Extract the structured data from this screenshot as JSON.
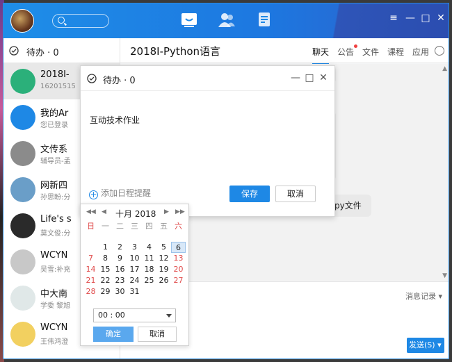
{
  "topbar": {
    "nav": [
      "message-icon",
      "contacts-icon",
      "files-icon"
    ],
    "window_controls": [
      "≡",
      "—",
      "□",
      "✕"
    ]
  },
  "sidebar": {
    "todo_label": "待办 · 0",
    "conversations": [
      {
        "name": "2018I-",
        "sub": "16201515",
        "color": "#2bb07a",
        "active": true
      },
      {
        "name": "我的Ar",
        "sub": "您已登录",
        "color": "#1e88e5"
      },
      {
        "name": "文传系",
        "sub": "辅导员-孟",
        "color": "#8b8b8b"
      },
      {
        "name": "网新四",
        "sub": "孙思盼:分",
        "color": "#6a9ec8"
      },
      {
        "name": "Life's s",
        "sub": "莫文俊:分",
        "color": "#2a2a2a"
      },
      {
        "name": "WCYN",
        "sub": "吴雪:补充",
        "color": "#c8c8c8"
      },
      {
        "name": "中大南",
        "sub": "学委 黎旭",
        "color": "#e0e8e8"
      },
      {
        "name": "WCYN",
        "sub": "王伟鸿澄",
        "color": "#f2d060"
      }
    ]
  },
  "chat": {
    "title": "2018I-Python语言",
    "tabs": [
      "聊天",
      "公告",
      "文件",
      "课程",
      "应用"
    ],
    "file_message": "个py文件",
    "history_label": "消息记录",
    "send_label": "发送(S)"
  },
  "todo_dialog": {
    "title": "待办 · 0",
    "content": "互动技术作业",
    "add_reminder": "添加日程提醒",
    "save": "保存",
    "cancel": "取消"
  },
  "calendar": {
    "month_title": "十月 2018",
    "weekdays": [
      "日",
      "一",
      "二",
      "三",
      "四",
      "五",
      "六"
    ],
    "weeks": [
      [
        "",
        "1",
        "2",
        "3",
        "4",
        "5",
        "6"
      ],
      [
        "7",
        "8",
        "9",
        "10",
        "11",
        "12",
        "13"
      ],
      [
        "14",
        "15",
        "16",
        "17",
        "18",
        "19",
        "20"
      ],
      [
        "21",
        "22",
        "23",
        "24",
        "25",
        "26",
        "27"
      ],
      [
        "28",
        "29",
        "30",
        "31",
        "",
        "",
        ""
      ]
    ],
    "selected_day": "6",
    "time": "00 : 00",
    "ok": "确定",
    "cancel": "取消"
  }
}
